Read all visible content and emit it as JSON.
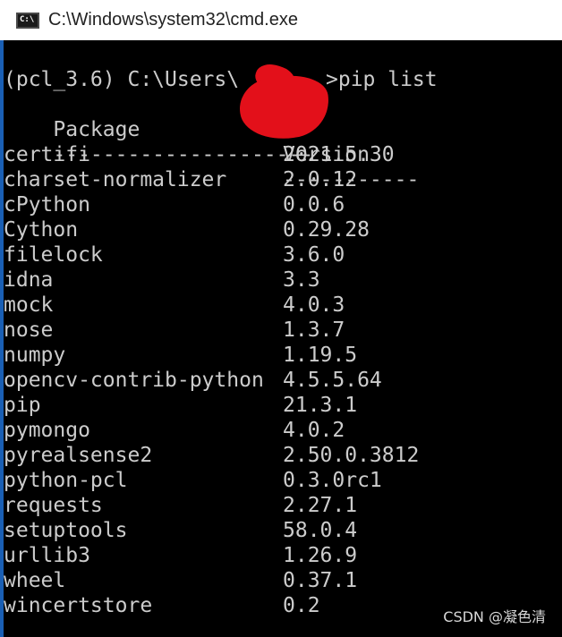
{
  "window": {
    "title": "C:\\Windows\\system32\\cmd.exe",
    "icon_text": "C:\\"
  },
  "console": {
    "prompt": "(pcl_3.6) C:\\Users\\",
    "prompt_suffix": ">pip list",
    "header": {
      "package": "Package",
      "version": "Version"
    },
    "separator": {
      "package": "---------------------",
      "version": "-----------"
    },
    "packages": [
      {
        "name": "certifi",
        "version": "2021.5.30"
      },
      {
        "name": "charset-normalizer",
        "version": "2.0.12"
      },
      {
        "name": "cPython",
        "version": "0.0.6"
      },
      {
        "name": "Cython",
        "version": "0.29.28"
      },
      {
        "name": "filelock",
        "version": "3.6.0"
      },
      {
        "name": "idna",
        "version": "3.3"
      },
      {
        "name": "mock",
        "version": "4.0.3"
      },
      {
        "name": "nose",
        "version": "1.3.7"
      },
      {
        "name": "numpy",
        "version": "1.19.5"
      },
      {
        "name": "opencv-contrib-python",
        "version": "4.5.5.64"
      },
      {
        "name": "pip",
        "version": "21.3.1"
      },
      {
        "name": "pymongo",
        "version": "4.0.2"
      },
      {
        "name": "pyrealsense2",
        "version": "2.50.0.3812"
      },
      {
        "name": "python-pcl",
        "version": "0.3.0rc1"
      },
      {
        "name": "requests",
        "version": "2.27.1"
      },
      {
        "name": "setuptools",
        "version": "58.0.4"
      },
      {
        "name": "urllib3",
        "version": "1.26.9"
      },
      {
        "name": "wheel",
        "version": "0.37.1"
      },
      {
        "name": "wincertstore",
        "version": "0.2"
      }
    ]
  },
  "watermark": "CSDN @凝色清",
  "colors": {
    "console_bg": "#000000",
    "console_text": "#cccccc",
    "titlebar_bg": "#ffffff",
    "redaction": "#e3101a"
  }
}
